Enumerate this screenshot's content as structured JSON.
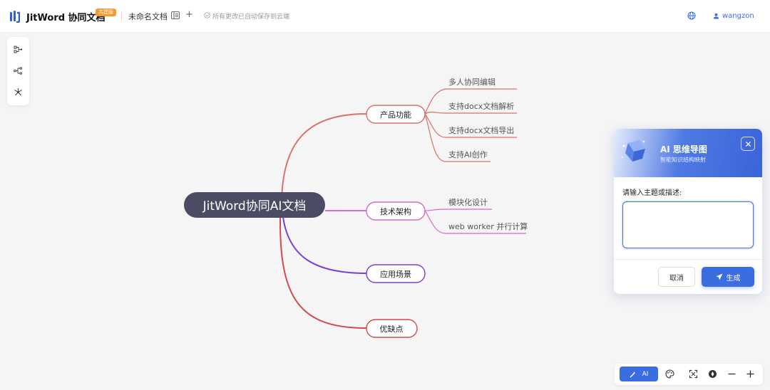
{
  "header": {
    "app_title": "JitWord 协同文档",
    "edition_badge": "共建版",
    "doc_name": "未命名文档",
    "add_label": "+",
    "save_status": "所有更改已自动保存到云端",
    "username": "wangzon"
  },
  "icons": {
    "logo": "logo-icon",
    "outline": "outline-icon",
    "saved": "check-circle-icon",
    "language": "globe-icon",
    "user": "user-icon",
    "left_toolbar": [
      "structure-right-icon",
      "structure-tree-icon",
      "structure-radial-icon"
    ],
    "bottom_toolbar": [
      "ai-wand-icon",
      "palette-icon",
      "fullscreen-icon",
      "navigator-icon",
      "zoom-out-icon",
      "zoom-in-icon"
    ]
  },
  "mindmap": {
    "root": "JitWord协同AI文档",
    "branches": [
      {
        "label": "产品功能",
        "color": "#d9716b",
        "children": [
          "多人协同编辑",
          "支持docx文档解析",
          "支持docx文档导出",
          "支持AI创作"
        ]
      },
      {
        "label": "技术架构",
        "color": "#d46bc8",
        "children": [
          "模块化设计",
          "web worker 并行计算"
        ]
      },
      {
        "label": "应用场景",
        "color": "#7c3fd6",
        "children": []
      },
      {
        "label": "优缺点",
        "color": "#d34b4b",
        "children": []
      }
    ],
    "root_color": "#4a4c63"
  },
  "ai_panel": {
    "title": "AI 思维导图",
    "subtitle": "智能知识结构映射",
    "prompt_label": "请输入主题或描述:",
    "input_value": "",
    "cancel_label": "取消",
    "generate_label": "生成"
  },
  "bottom_toolbar": {
    "ai_label": "AI"
  },
  "colors": {
    "accent": "#3b6de0",
    "badge": "#f39a2b",
    "background": "#f5f5f6"
  }
}
